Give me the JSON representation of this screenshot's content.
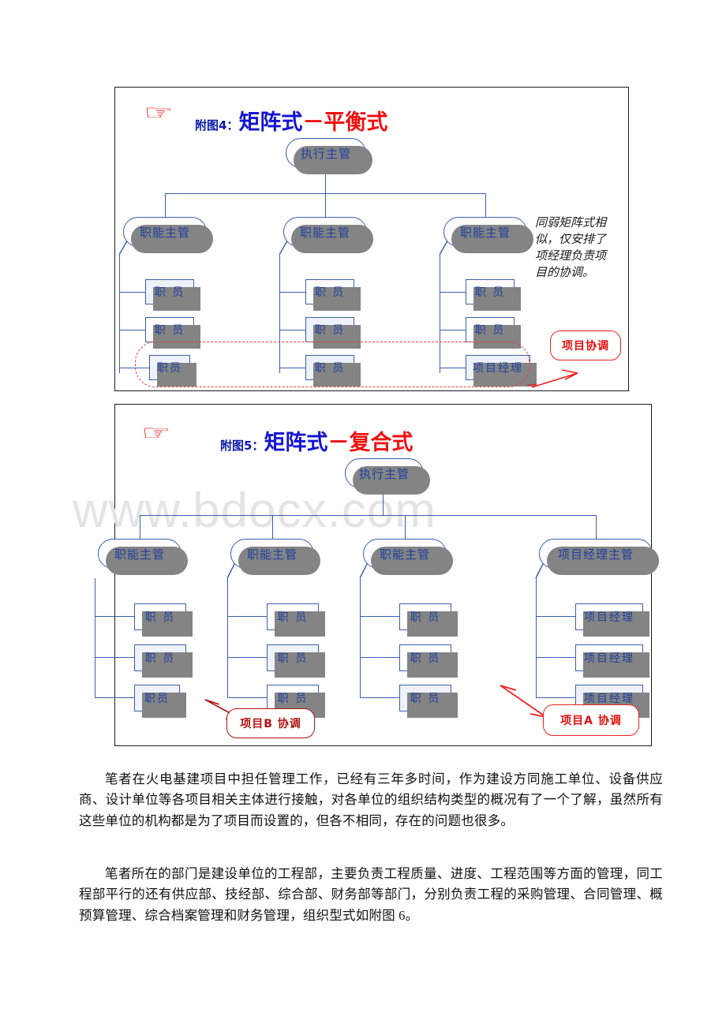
{
  "watermark": "www.bdocx.com",
  "figure4": {
    "pointer_icon": "☞",
    "label": "附图4：",
    "title_blue": "矩阵式",
    "title_red": "－平衡式",
    "root": "执行主管",
    "managers": [
      "职能主管",
      "职能主管",
      "职能主管"
    ],
    "columns": [
      [
        "职 员",
        "职 员",
        "职员"
      ],
      [
        "职 员",
        "职 员",
        "职 员"
      ],
      [
        "职 员",
        "职 员",
        "项目经理"
      ]
    ],
    "side_note": "同弱矩阵式相似，仅安排了项经理负责项目的协调。",
    "callout": "项目协调"
  },
  "figure5": {
    "pointer_icon": "☞",
    "label": "附图5：",
    "title_blue": "矩阵式",
    "title_red": "－复合式",
    "root": "执行主管",
    "managers": [
      "职能主管",
      "职能主管",
      "职能主管",
      "项目经理主管"
    ],
    "columns": [
      [
        "职 员",
        "职 员",
        "职员"
      ],
      [
        "职 员",
        "职 员",
        "职 员"
      ],
      [
        "职 员",
        "职 员",
        "职 员"
      ],
      [
        "项目经理",
        "项目经理",
        "项目经理"
      ]
    ],
    "callout_left": "项目B 协调",
    "callout_right": "项目A 协调"
  },
  "body": {
    "paragraph1": "笔者在火电基建项目中担任管理工作，已经有三年多时间，作为建设方同施工单位、设备供应商、设计单位等各项目相关主体进行接触，对各单位的组织结构类型的概况有了一个了解，虽然所有这些单位的机构都是为了项目而设置的，但各不相同，存在的问题也很多。",
    "paragraph2": "笔者所在的部门是建设单位的工程部，主要负责工程质量、进度、工程范围等方面的管理，同工程部平行的还有供应部、技经部、综合部、财务部等部门，分别负责工程的采购管理、合同管理、概预算管理、综合档案管理和财务管理，组织型式如附图 6。"
  },
  "colors": {
    "node_border": "#3a5fae",
    "node_text": "#1e3f9e",
    "accent_red": "#ee1111",
    "title_blue": "#1414d2",
    "shadow": "#848484"
  }
}
